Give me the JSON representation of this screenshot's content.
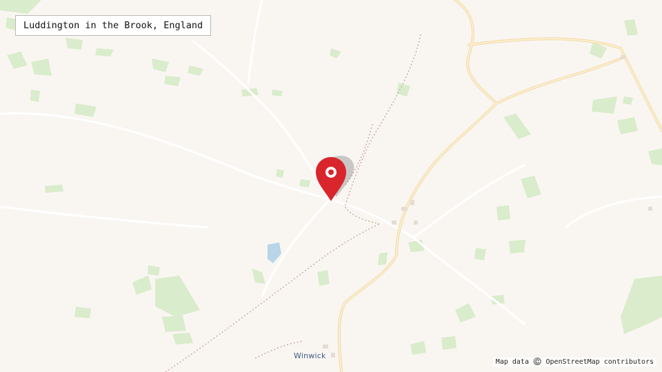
{
  "location_label": "Luddington in the Brook, England",
  "place_labels": [
    "Winwick"
  ],
  "attribution": "Map data ©️ OpenStreetMap contributors",
  "marker": {
    "icon": "map-pin-icon",
    "color": "#d9262c"
  },
  "colors": {
    "background": "#f9f6f2",
    "woodland": "#d6ebc7",
    "major_road": "#f7e3b8",
    "minor_road": "#ffffff",
    "path": "#c9a8a0",
    "water": "#b8d6e8"
  }
}
